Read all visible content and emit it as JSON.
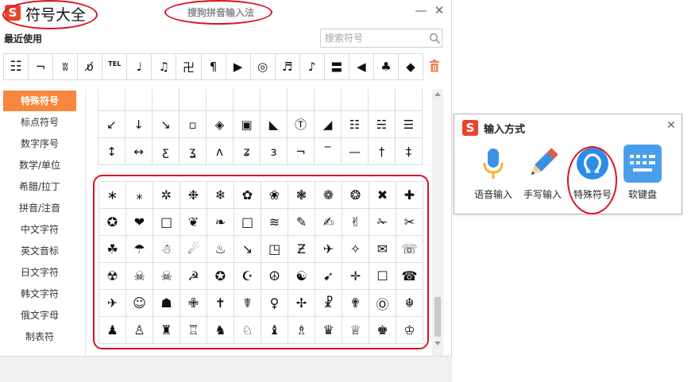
{
  "window": {
    "logo_letter": "S",
    "title": "符号大全",
    "app_name": "搜狗拼音输入法",
    "minimize_glyph": "—",
    "close_glyph": "✕"
  },
  "recent": {
    "label": "最近使用",
    "symbols": [
      "☷",
      "¬",
      "ʬ",
      "ʋ̸",
      "TEL",
      "♩",
      "♫",
      "卍",
      "¶",
      "▶",
      "◎",
      "♬",
      "♪",
      "〓",
      "◀",
      "♣",
      "◆"
    ]
  },
  "search": {
    "placeholder": "搜索符号",
    "value": ""
  },
  "sidebar": {
    "items": [
      {
        "label": "特殊符号",
        "active": true
      },
      {
        "label": "标点符号",
        "active": false
      },
      {
        "label": "数字序号",
        "active": false
      },
      {
        "label": "数学/单位",
        "active": false
      },
      {
        "label": "希腊/拉丁",
        "active": false
      },
      {
        "label": "拼音/注音",
        "active": false
      },
      {
        "label": "中文字符",
        "active": false
      },
      {
        "label": "英文音标",
        "active": false
      },
      {
        "label": "日文字符",
        "active": false
      },
      {
        "label": "韩文字符",
        "active": false
      },
      {
        "label": "俄文字母",
        "active": false
      },
      {
        "label": "制表符",
        "active": false
      }
    ]
  },
  "grid_top": [
    [
      "",
      "",
      "",
      "",
      "",
      "",
      "",
      "",
      "",
      "",
      "",
      ""
    ],
    [
      "↙",
      "↓",
      "↘",
      "▫",
      "◈",
      "▣",
      "◣",
      "Ⓣ",
      "◢",
      "☷",
      "☵",
      "☰"
    ],
    [
      "↕",
      "↔",
      "ƹ",
      "ʓ",
      "ʌ",
      "ʑ",
      "ɜ",
      "¬",
      "‾",
      "—",
      "†",
      "‡"
    ]
  ],
  "grid_main": [
    [
      "∗",
      "⁎",
      "✲",
      "❉",
      "❄",
      "✿",
      "❀",
      "❃",
      "❁",
      "❂",
      "✖",
      "✚"
    ],
    [
      "✪",
      "❤",
      "□",
      "❦",
      "❧",
      "□",
      "≋",
      "✎",
      "✍",
      "✌",
      "✁",
      "✂"
    ],
    [
      "☘",
      "☂",
      "☃",
      "☄",
      "♨",
      "↘",
      "◳",
      "Ƶ",
      "✈",
      "✧",
      "✉",
      "☏"
    ],
    [
      "☢",
      "☠",
      "☠",
      "☭",
      "✪",
      "☪",
      "☮",
      "☯",
      "➹",
      "✛",
      "☐",
      "☎"
    ],
    [
      "✈",
      "☺",
      "☗",
      "✙",
      "✝",
      "☤",
      "♀",
      "✢",
      "☧",
      "✟",
      "Ⓞ",
      "☬"
    ],
    [
      "♟",
      "♙",
      "♜",
      "♖",
      "♞",
      "♘",
      "♝",
      "♗",
      "♛",
      "♕",
      "♚",
      "♔"
    ]
  ],
  "ime": {
    "title": "输入方式",
    "close_glyph": "✕",
    "options": [
      {
        "label": "语音输入",
        "icon": "microphone-icon"
      },
      {
        "label": "手写输入",
        "icon": "pencil-icon"
      },
      {
        "label": "特殊符号",
        "icon": "omega-icon"
      },
      {
        "label": "软键盘",
        "icon": "keyboard-icon"
      }
    ]
  },
  "colors": {
    "accent_orange": "#f7873d",
    "logo_red": "#e8442c",
    "annotation_red": "#d9141e",
    "mic_blue": "#3b92e6",
    "mic_yellow": "#f3b72a",
    "keyboard_blue": "#4a9fec"
  }
}
